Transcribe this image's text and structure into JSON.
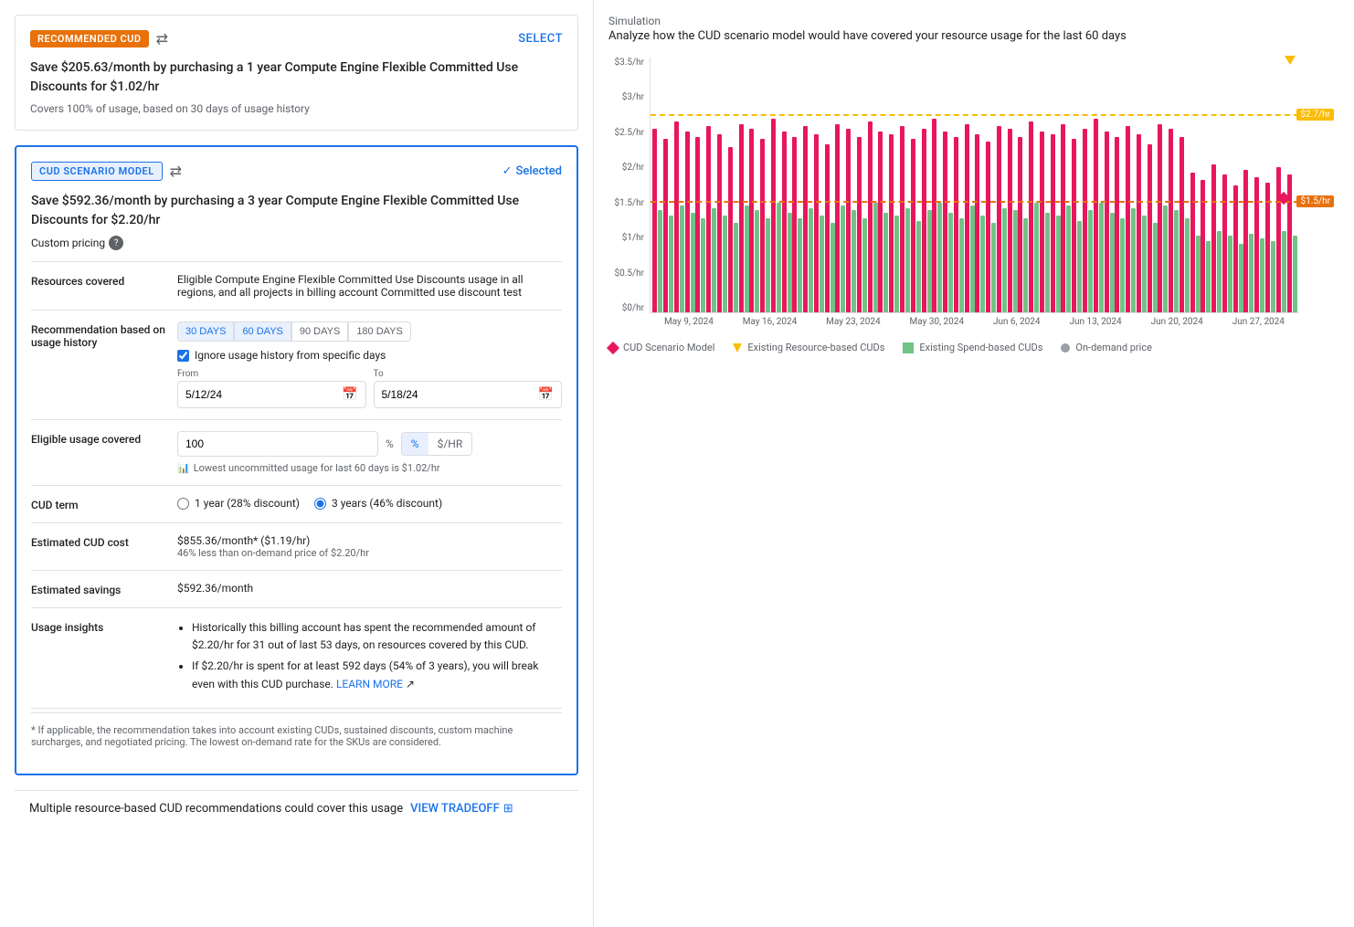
{
  "recommended_card": {
    "badge": "RECOMMENDED CUD",
    "select_label": "SELECT",
    "title": "Save $205.63/month by purchasing a 1 year Compute Engine Flexible Committed Use Discounts for $1.02/hr",
    "subtitle": "Covers 100% of usage, based on 30 days of usage history"
  },
  "scenario_card": {
    "badge": "CUD SCENARIO MODEL",
    "selected_label": "Selected",
    "title": "Save $592.36/month by purchasing a 3 year Compute Engine Flexible Committed Use Discounts for $2.20/hr",
    "custom_pricing_label": "Custom pricing",
    "resources_covered_label": "Resources covered",
    "resources_covered_value": "Eligible Compute Engine Flexible Committed Use Discounts usage in all regions, and all projects in billing account Committed use discount test",
    "recommendation_label": "Recommendation based on usage history",
    "day_buttons": [
      "30 DAYS",
      "60 DAYS",
      "90 DAYS",
      "180 DAYS"
    ],
    "active_day": "60 DAYS",
    "ignore_label": "Ignore usage history from specific days",
    "from_label": "From",
    "to_label": "To",
    "from_value": "5/12/24",
    "to_value": "5/18/24",
    "eligible_label": "Eligible usage covered",
    "eligible_value": "100",
    "percent_symbol": "%",
    "toggle_percent": "%",
    "toggle_usd": "$/HR",
    "usage_hint": "Lowest uncommitted usage for last 60 days is $1.02/hr",
    "cud_term_label": "CUD term",
    "one_year_label": "1 year (28% discount)",
    "three_year_label": "3 years (46% discount)",
    "estimated_cost_label": "Estimated CUD cost",
    "estimated_cost_value": "$855.36/month* ($1.19/hr)",
    "estimated_cost_sub": "46% less than on-demand price of $2.20/hr",
    "estimated_savings_label": "Estimated savings",
    "estimated_savings_value": "$592.36/month",
    "usage_insights_label": "Usage insights",
    "insight1": "Historically this billing account has spent the recommended amount of $2.20/hr for 31 out of last 53 days, on resources covered by this CUD.",
    "insight2": "If $2.20/hr is spent for at least 592 days (54% of 3 years), you will break even with this CUD purchase.",
    "learn_more": "LEARN MORE",
    "footnote": "* If applicable, the recommendation takes into account existing CUDs, sustained discounts, custom machine surcharges, and negotiated pricing. The lowest on-demand rate for the SKUs are considered."
  },
  "bottom_bar": {
    "text": "Multiple resource-based CUD recommendations could cover this usage",
    "link": "VIEW TRADEOFF"
  },
  "simulation": {
    "label": "Simulation",
    "description": "Analyze how the CUD scenario model would have covered your resource usage for the last 60 days",
    "y_labels": [
      "$3.5/hr",
      "$3/hr",
      "$2.5/hr",
      "$2/hr",
      "$1.5/hr",
      "$1/hr",
      "$0.5/hr",
      "$0/hr"
    ],
    "x_labels": [
      "May 9, 2024",
      "May 16, 2024",
      "May 23, 2024",
      "May 30, 2024",
      "Jun 6, 2024",
      "Jun 13, 2024",
      "Jun 20, 2024",
      "Jun 27, 2024"
    ],
    "ref_line_27_label": "$2.7/hr",
    "ref_line_15_label": "$1.5/hr",
    "legend": [
      {
        "label": "CUD Scenario Model",
        "type": "diamond"
      },
      {
        "label": "Existing Resource-based CUDs",
        "type": "triangle"
      },
      {
        "label": "Existing Spend-based CUDs",
        "type": "square"
      },
      {
        "label": "On-demand price",
        "type": "circle"
      }
    ]
  }
}
